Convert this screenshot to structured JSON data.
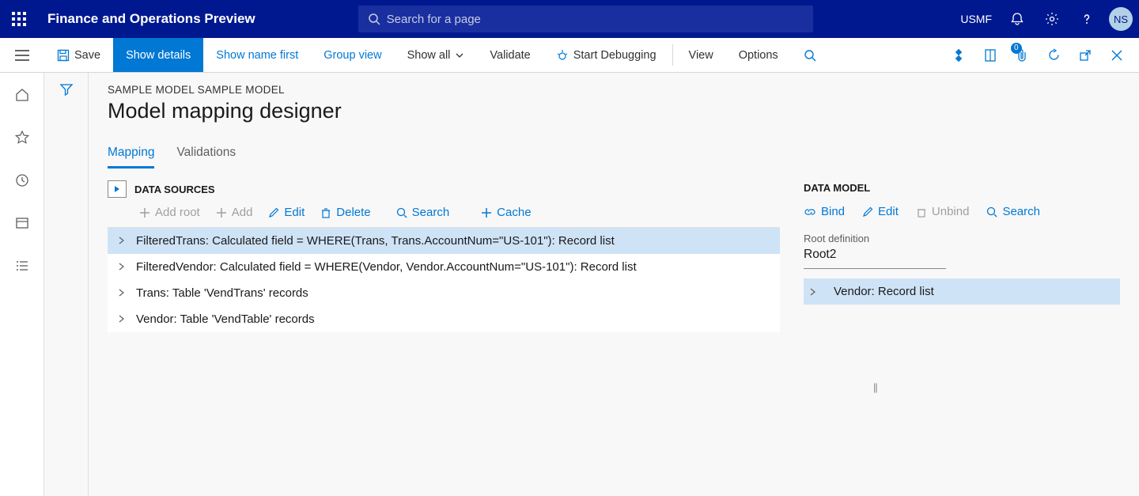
{
  "topbar": {
    "brand": "Finance and Operations Preview",
    "search_placeholder": "Search for a page",
    "company": "USMF",
    "user_initials": "NS"
  },
  "actionbar": {
    "save": "Save",
    "show_details": "Show details",
    "show_name_first": "Show name first",
    "group_view": "Group view",
    "show_all": "Show all",
    "validate": "Validate",
    "start_debugging": "Start Debugging",
    "view": "View",
    "options": "Options",
    "attachment_count": "0"
  },
  "page": {
    "breadcrumb": "SAMPLE MODEL SAMPLE MODEL",
    "title": "Model mapping designer",
    "tabs": {
      "mapping": "Mapping",
      "validations": "Validations"
    }
  },
  "datasources": {
    "heading": "DATA SOURCES",
    "toolbar": {
      "add_root": "Add root",
      "add": "Add",
      "edit": "Edit",
      "delete": "Delete",
      "search": "Search",
      "cache": "Cache"
    },
    "rows": [
      "FilteredTrans: Calculated field = WHERE(Trans, Trans.AccountNum=\"US-101\"): Record list",
      "FilteredVendor: Calculated field = WHERE(Vendor, Vendor.AccountNum=\"US-101\"): Record list",
      "Trans: Table 'VendTrans' records",
      "Vendor: Table 'VendTable' records"
    ]
  },
  "datamodel": {
    "heading": "DATA MODEL",
    "toolbar": {
      "bind": "Bind",
      "edit": "Edit",
      "unbind": "Unbind",
      "search": "Search"
    },
    "root_label": "Root definition",
    "root_value": "Root2",
    "rows": [
      "Vendor: Record list"
    ]
  }
}
